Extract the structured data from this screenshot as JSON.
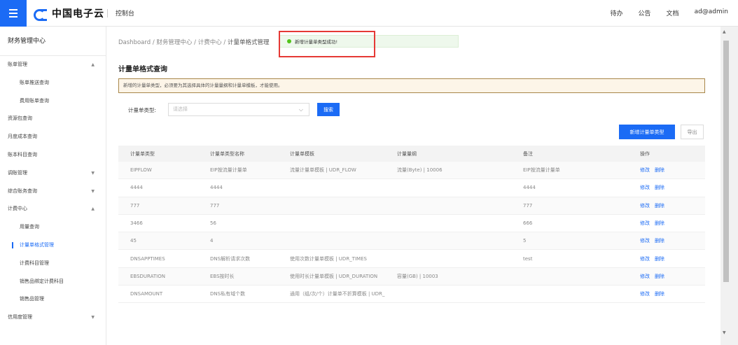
{
  "topbar": {
    "logo_text": "中国电子云",
    "console": "控制台",
    "links": [
      "待办",
      "公告",
      "文档",
      "ad@admin"
    ]
  },
  "sidebar": {
    "title": "财务管理中心",
    "items": [
      {
        "label": "账单管理",
        "level": 1,
        "chevron": "up"
      },
      {
        "label": "账单推送查询",
        "level": 2
      },
      {
        "label": "费用账单查询",
        "level": 2
      },
      {
        "label": "资源包查询",
        "level": 1
      },
      {
        "label": "月度成本查询",
        "level": 1
      },
      {
        "label": "账本科目查询",
        "level": 1
      },
      {
        "label": "调账管理",
        "level": 1,
        "chevron": "down"
      },
      {
        "label": "综合账务查询",
        "level": 1,
        "chevron": "down"
      },
      {
        "label": "计费中心",
        "level": 1,
        "chevron": "up"
      },
      {
        "label": "用量查询",
        "level": 2
      },
      {
        "label": "计量单格式管理",
        "level": 2,
        "active": true
      },
      {
        "label": "计费科目管理",
        "level": 2
      },
      {
        "label": "销售品绑定计费科目",
        "level": 2
      },
      {
        "label": "销售品管理",
        "level": 2
      },
      {
        "label": "信用度管理",
        "level": 1,
        "chevron": "down"
      }
    ]
  },
  "breadcrumb": [
    "Dashboard",
    "财务管理中心",
    "计费中心",
    "计量单格式管理"
  ],
  "breadcrumb_sep": "/",
  "toast": "新增计量单类型成功!",
  "page_title": "计量单格式查询",
  "notice": "新增的计量单类型，必须要为其选择具体的计量量纲和计量单模板，才能使用。",
  "filter": {
    "label": "计量单类型:",
    "placeholder": "请选择",
    "search_button": "搜索"
  },
  "buttons": {
    "add": "新增计量单类型",
    "export": "导出"
  },
  "table": {
    "columns": [
      "计量单类型",
      "计量单类型名称",
      "计量单模板",
      "计量量纲",
      "备注",
      "操作"
    ],
    "actions": [
      "修改",
      "删除"
    ],
    "rows": [
      [
        "EIPFLOW",
        "EIP按流量计量单",
        "流量计量单模板 | UDR_FLOW",
        "流量(Byte) | 10006",
        "EIP按流量计量单"
      ],
      [
        "4444",
        "4444",
        "",
        "",
        "4444"
      ],
      [
        "777",
        "777",
        "",
        "",
        "777"
      ],
      [
        "3466",
        "56",
        "",
        "",
        "666"
      ],
      [
        "45",
        "4",
        "",
        "",
        "5"
      ],
      [
        "DNSAPPTIMES",
        "DNS解析请求次数",
        "使用次数计量单模板 | UDR_TIMES",
        "",
        "test"
      ],
      [
        "EBSDURATION",
        "EBS按时长",
        "使用时长计量单模板 | UDR_DURATION",
        "容量(GB) | 10003",
        ""
      ],
      [
        "DNSAMOUNT",
        "DNS私有域个数",
        "通用（组/次/个）计量单不折算模板 | UDR_",
        "",
        ""
      ]
    ]
  },
  "colors": {
    "primary": "#1b6bf5",
    "success": "#52c41a",
    "highlight": "#e53935"
  }
}
